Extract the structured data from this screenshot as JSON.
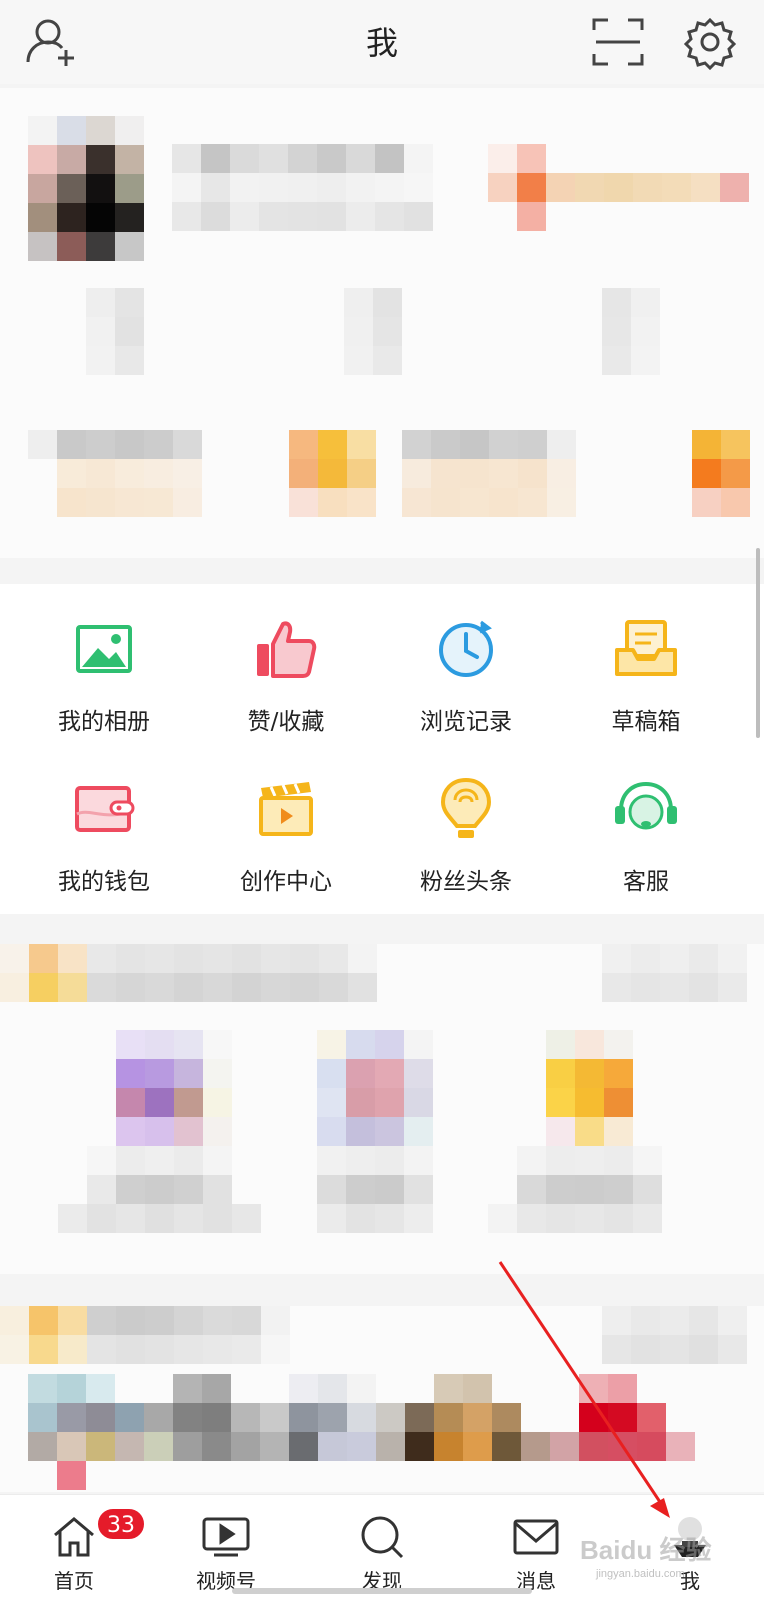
{
  "header": {
    "title": "我",
    "add_friend_icon": "add-friend-icon",
    "scan_icon": "scan-icon",
    "settings_icon": "gear-icon"
  },
  "tools": [
    {
      "label": "我的相册",
      "icon": "photo-album-icon",
      "color": "#2fbf71"
    },
    {
      "label": "赞/收藏",
      "icon": "thumbs-up-icon",
      "color": "#ee4b5f"
    },
    {
      "label": "浏览记录",
      "icon": "clock-icon",
      "color": "#2c9be0"
    },
    {
      "label": "草稿箱",
      "icon": "draft-box-icon",
      "color": "#f5b51a"
    },
    {
      "label": "我的钱包",
      "icon": "wallet-icon",
      "color": "#ee4b5f",
      "has_dot": true
    },
    {
      "label": "创作中心",
      "icon": "clapperboard-icon",
      "color": "#f5b51a"
    },
    {
      "label": "粉丝头条",
      "icon": "lightbulb-icon",
      "color": "#f5b51a"
    },
    {
      "label": "客服",
      "icon": "headset-icon",
      "color": "#2fbf71"
    }
  ],
  "tabbar": [
    {
      "label": "首页",
      "icon": "home-icon",
      "badge": "33"
    },
    {
      "label": "视频号",
      "icon": "video-icon"
    },
    {
      "label": "发现",
      "icon": "search-icon"
    },
    {
      "label": "消息",
      "icon": "envelope-icon"
    },
    {
      "label": "我",
      "icon": "profile-icon"
    }
  ],
  "watermark": {
    "brand": "Baidu 经验",
    "site": "jingyan.baidu.com"
  },
  "colors": {
    "accent_red": "#e51b2a",
    "annotation_arrow": "#e82020"
  }
}
